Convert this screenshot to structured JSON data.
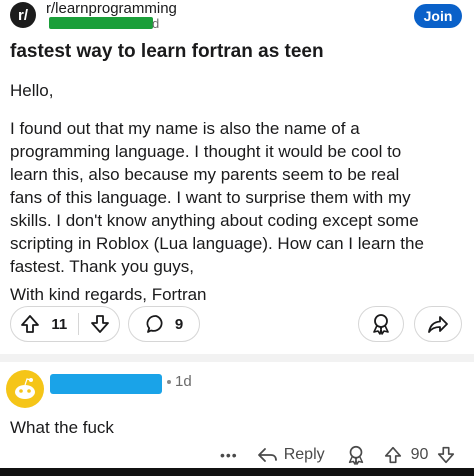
{
  "post": {
    "subreddit": "r/learnprogramming",
    "subreddit_icon_letter": "r/",
    "author_fragment": "d",
    "join_label": "Join",
    "title": "fastest way to learn fortran as teen",
    "greeting": "Hello,",
    "body_lines": [
      "I found out that my name is also the name of a",
      "programming language. I thought it would be cool to",
      "learn this, also because my parents seem to be real",
      "fans of this language. I want to surprise them with my",
      "skills. I don't know anything about coding except some",
      "scripting in Roblox (Lua language). How can I learn the",
      "fastest. Thank you guys,"
    ],
    "signoff": "With kind regards, Fortran",
    "actions": {
      "score": "11",
      "comments": "9"
    }
  },
  "comment": {
    "age": "1d",
    "text": "What the fuck",
    "footer": {
      "more_label": "•••",
      "reply_label": "Reply",
      "score": "90"
    }
  },
  "colors": {
    "join": "#0a61c9",
    "redact_green": "#1b9f3a",
    "redact_blue": "#1aa3e8",
    "avatar": "#f5c518"
  }
}
